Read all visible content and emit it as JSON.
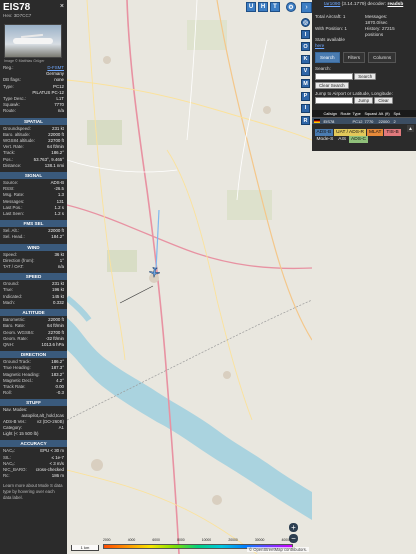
{
  "info": {
    "callsign": "EIS78",
    "hex_label": "Hex: 3D7CC7",
    "close_icon": "×",
    "photo_credit": "Image © Matthias Grüger",
    "general": [
      {
        "k": "Reg.:",
        "v": "D-FSMT",
        "link": true
      },
      {
        "k": "",
        "v": "Germany"
      },
      {
        "k": "DB flags:",
        "v": "none"
      },
      {
        "k": "Type:",
        "v": "PC12"
      },
      {
        "k": "",
        "v": "PILATUS PC-12"
      },
      {
        "k": "Type Desc.:",
        "v": "L1T"
      },
      {
        "k": "Squawk:",
        "v": "7770"
      },
      {
        "k": "Route:",
        "v": "n/a"
      }
    ],
    "sections": [
      {
        "title": "SPATIAL",
        "rows": [
          {
            "k": "Groundspeed:",
            "v": "231 kt"
          },
          {
            "k": "Baro. altitude:",
            "v": "22000 ft"
          },
          {
            "k": "WGS84 altitude:",
            "v": "22700 ft"
          },
          {
            "k": "Vert. Rate:",
            "v": "64 ft/min"
          },
          {
            "k": "Track:",
            "v": "186.2°"
          },
          {
            "k": "Pos.:",
            "v": "53.763°, 9.465°"
          },
          {
            "k": "Distance:",
            "v": "138.1 nmi"
          }
        ]
      },
      {
        "title": "SIGNAL",
        "rows": [
          {
            "k": "Source:",
            "v": "ADS-B"
          },
          {
            "k": "RSSI:",
            "v": "-26.5"
          },
          {
            "k": "Msg. Rate:",
            "v": "1.3"
          },
          {
            "k": "Messages:",
            "v": "131"
          },
          {
            "k": "Last Pos.:",
            "v": "1.2 s"
          },
          {
            "k": "Last Seen:",
            "v": "1.2 s"
          }
        ]
      },
      {
        "title": "FMS SEL",
        "rows": [
          {
            "k": "Sel. Alt.:",
            "v": "22000 ft"
          },
          {
            "k": "Sel. Head.:",
            "v": "184.2°"
          }
        ]
      },
      {
        "title": "WIND",
        "rows": [
          {
            "k": "Speed:",
            "v": "36 kt"
          },
          {
            "k": "Direction (from):",
            "v": "1°"
          },
          {
            "k": "TAT / OAT:",
            "v": "n/a"
          }
        ]
      },
      {
        "title": "SPEED",
        "rows": [
          {
            "k": "Ground:",
            "v": "231 kt"
          },
          {
            "k": "True:",
            "v": "196 kt"
          },
          {
            "k": "Indicated:",
            "v": "145 kt"
          },
          {
            "k": "Mach:",
            "v": "0.332"
          }
        ]
      },
      {
        "title": "ALTITUDE",
        "rows": [
          {
            "k": "Barometric:",
            "v": "22000 ft"
          },
          {
            "k": "Baro. Rate:",
            "v": "64 ft/min"
          },
          {
            "k": "Geom. WGS84:",
            "v": "22700 ft"
          },
          {
            "k": "Geom. Rate:",
            "v": "-32 ft/min"
          },
          {
            "k": "QNH:",
            "v": "1013.6 hPa"
          }
        ]
      },
      {
        "title": "DIRECTION",
        "rows": [
          {
            "k": "Ground Track:",
            "v": "186.2°"
          },
          {
            "k": "True Heading:",
            "v": "187.3°"
          },
          {
            "k": "Magnetic Heading:",
            "v": "183.2°"
          },
          {
            "k": "Magnetic Decl.:",
            "v": "4.2°"
          },
          {
            "k": "Track Rate:",
            "v": "0.00"
          },
          {
            "k": "Roll:",
            "v": "-0.3"
          }
        ]
      }
    ],
    "stuff": {
      "title": "STUFF",
      "nav_modes_label": "Nav. Modes:",
      "nav_modes_value": "autopilot,alt_hold,tcas",
      "adsb_label": "ADS-B Ver.:",
      "adsb_value": "v2 (DO-260B)",
      "category_label": "Category:",
      "category_value": "A1",
      "category_desc": "Light (< 15 500 lb)"
    },
    "accuracy": {
      "title": "ACCURACY",
      "rows": [
        {
          "k": "NACₚ:",
          "v": "EPU < 30 m"
        },
        {
          "k": "SIL:",
          "v": "≤ 1e-7"
        },
        {
          "k": "NACᵥ:",
          "v": "< 3 m/s"
        },
        {
          "k": "NIC_BARO:",
          "v": "cross-checked"
        },
        {
          "k": "Rc:",
          "v": "186 m"
        }
      ]
    },
    "footnote": "Learn more about Mode S data type by hovering over each data label."
  },
  "map": {
    "top_buttons": [
      "U",
      "H",
      "T"
    ],
    "side_buttons": [
      "I",
      "O",
      "K",
      "V",
      "M",
      "P",
      "I",
      "R"
    ],
    "zoom_in": "+",
    "zoom_out": "−",
    "scale": "1 km",
    "attribution": "© OpenStreetMap contributors.",
    "alt_ticks": [
      "2000",
      "4000",
      "6000",
      "8000",
      "10000",
      "20000",
      "30000",
      "40000+"
    ],
    "aircraft_heading_deg": 186.2
  },
  "right": {
    "version_prefix": "tar1090",
    "version_suffix": "(3.14.1779) decoder:",
    "decoder": "readsb",
    "stats": {
      "total_aircraft_label": "Total Aircraft:",
      "total_aircraft_value": "1",
      "with_position_label": "With Position:",
      "with_position_value": "1",
      "stats_available": "Stats available",
      "stats_link": "here",
      "messages_label": "Messages:",
      "messages_value": "1870.0/sec",
      "history_label": "History:",
      "history_value": "27215 positions"
    },
    "tabs": [
      "Search",
      "Filters",
      "Columns"
    ],
    "search_label": "Search:",
    "search_button": "Search",
    "clear_search_button": "Clear Search",
    "jump_label": "Jump to Airport or Latitude, Longitude:",
    "jump_button": "Jump",
    "clear_button": "Clear",
    "columns": [
      "",
      "Callsign",
      "Route",
      "Type",
      "Squawk",
      "Alt. (ft)",
      "Spd."
    ],
    "rows": [
      {
        "flag": "",
        "callsign": "EIS78",
        "route": "",
        "type": "PC12",
        "squawk": "7770",
        "alt": "22000",
        "spd": "2"
      }
    ],
    "legend": [
      {
        "label": "ADS-B",
        "color": "#4a7bb0"
      },
      {
        "label": "UAT / ADS-R",
        "color": "#e2c85a"
      },
      {
        "label": "MLAT",
        "color": "#e78a3a"
      },
      {
        "label": "TIS-B",
        "color": "#e0797c"
      },
      {
        "label": "Mode-S",
        "color": "#ffffff"
      },
      {
        "label": "AIS",
        "color": "#ffffff"
      },
      {
        "label": "ADS-C",
        "color": "#8fc07a"
      }
    ],
    "to_top_icon": "▲"
  }
}
